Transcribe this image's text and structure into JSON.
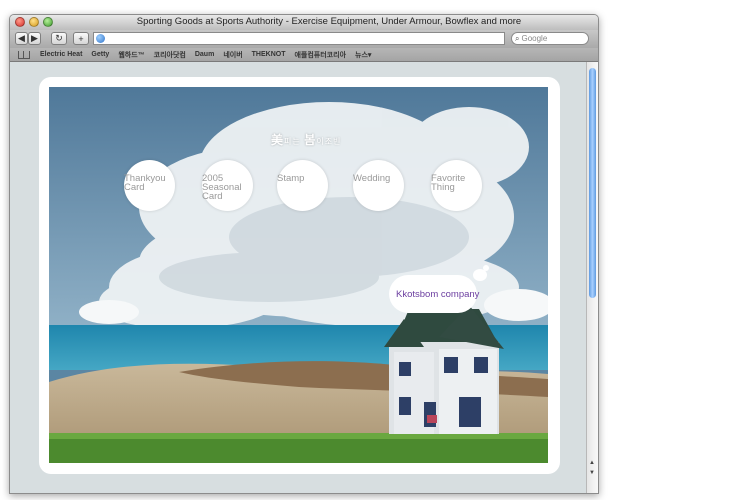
{
  "browser": {
    "title": "Sporting Goods at Sports Authority - Exercise Equipment, Under Armour, Bowflex and more",
    "nav": {
      "back": "◀",
      "forward": "▶",
      "reload": "↻",
      "add": "+"
    },
    "url": "",
    "search_placeholder": "Google",
    "bookmarks": [
      "Electric Heat",
      "Getty",
      "웹하드™",
      "코리아닷컴",
      "Daum",
      "네이버",
      "THEKNOT",
      "애플컴퓨터코리아",
      "뉴스▾"
    ]
  },
  "page": {
    "logo": {
      "part1": "美",
      "part2": "피는 ",
      "part3": "봄",
      "part4": "이조빈"
    },
    "menu": [
      {
        "label": "Thankyou Card"
      },
      {
        "label": "2005 Seasonal Card"
      },
      {
        "label": "Stamp"
      },
      {
        "label": "Wedding"
      },
      {
        "label": "Favorite Thing"
      }
    ],
    "company": "Kkotsbom company"
  },
  "colors": {
    "menu_text": "#9a9a9a",
    "company_text": "#6c3fa0",
    "scrollbar_thumb": "#5f9be0"
  }
}
